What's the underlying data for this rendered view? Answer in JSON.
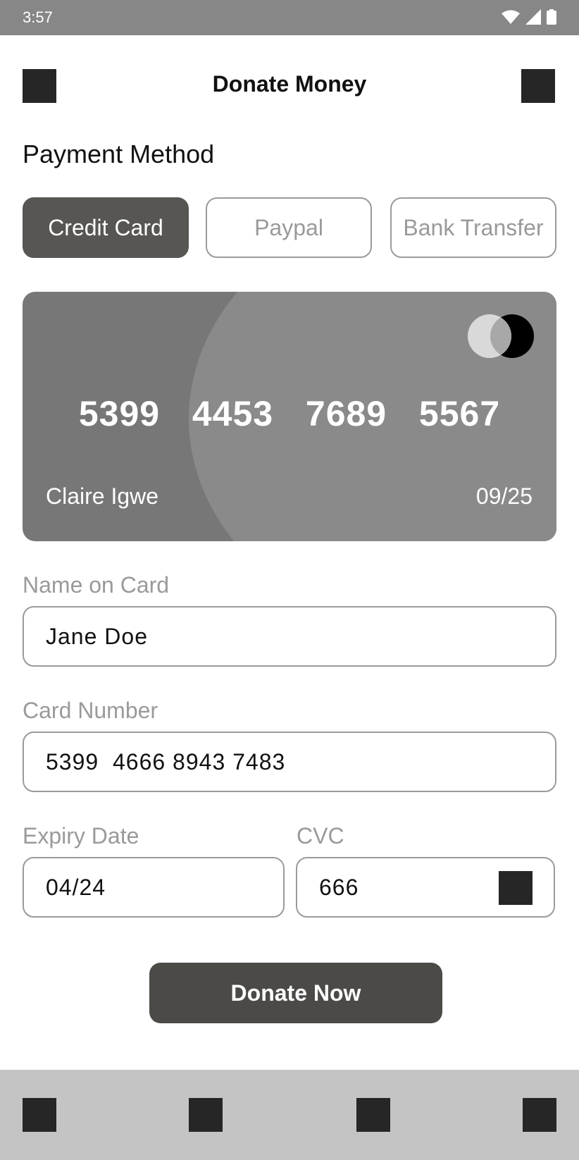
{
  "status_bar": {
    "time": "3:57",
    "icons": [
      "wifi-icon",
      "signal-icon",
      "battery-icon"
    ]
  },
  "header": {
    "title": "Donate Money",
    "left_icon": "menu-icon",
    "right_icon": "profile-icon"
  },
  "payment": {
    "section_title": "Payment Method",
    "tabs": [
      {
        "label": "Credit Card",
        "active": true
      },
      {
        "label": "Paypal",
        "active": false
      },
      {
        "label": "Bank Transfer",
        "active": false
      }
    ]
  },
  "card": {
    "number": "5399  4453  7689  5567",
    "holder": "Claire Igwe",
    "expiry": "09/25",
    "logo": "mastercard-logo"
  },
  "form": {
    "name": {
      "label": "Name on Card",
      "value": "Jane Doe"
    },
    "number": {
      "label": "Card Number",
      "value": "5399  4666 8943 7483"
    },
    "expiry": {
      "label": "Expiry Date",
      "value": "04/24"
    },
    "cvc": {
      "label": "CVC",
      "value": "666",
      "icon": "card-cvc-icon"
    }
  },
  "actions": {
    "donate_label": "Donate Now"
  },
  "bottom_nav": {
    "items": [
      "home-icon",
      "explore-icon",
      "donate-icon",
      "profile-icon"
    ]
  },
  "colors": {
    "status_bar": "#878787",
    "active_tab": "#575653",
    "card_base": "#777777",
    "card_arc": "#8a8a8a",
    "button": "#4b4a47",
    "bottom_nav": "#c4c4c4",
    "muted_text": "#9a9a9a"
  }
}
